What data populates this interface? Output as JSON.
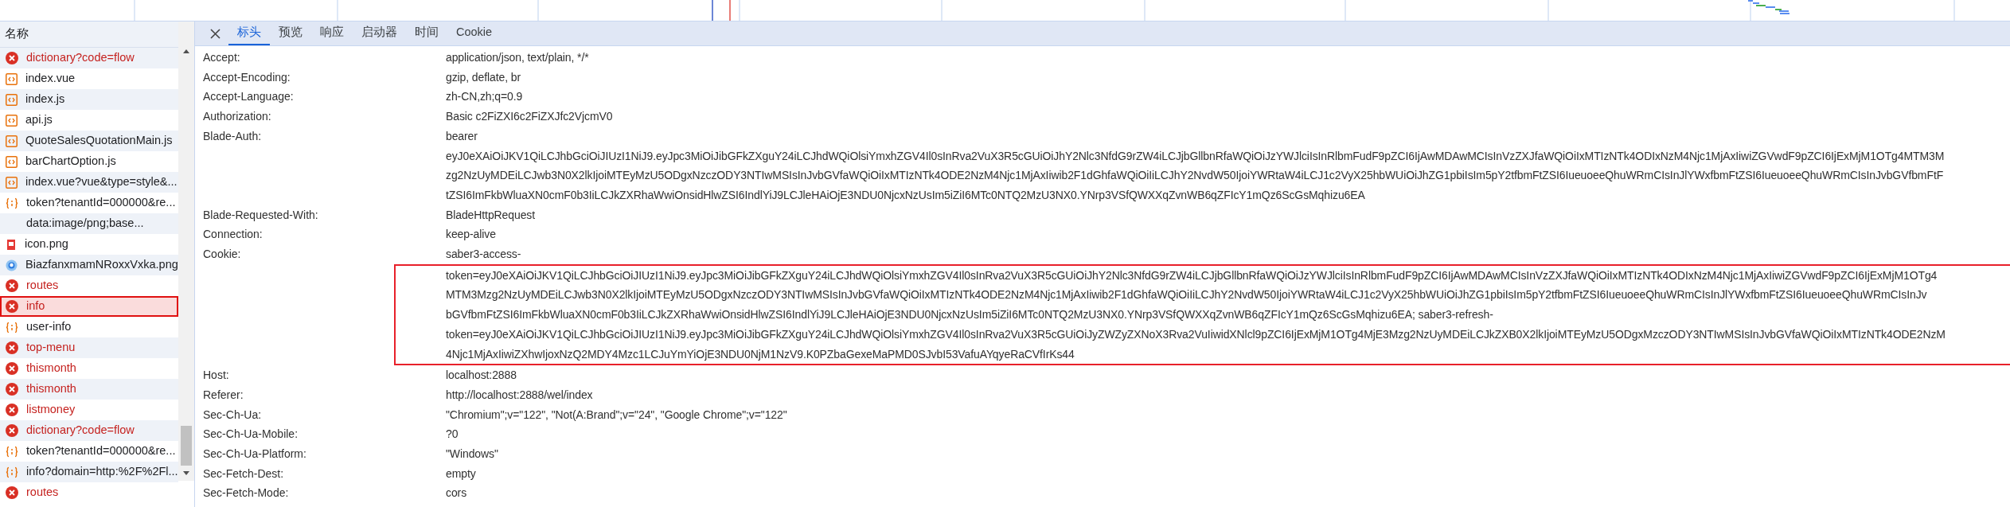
{
  "requests": {
    "header": "名称",
    "items": [
      {
        "name": "dictionary?code=flow",
        "kind": "error",
        "selected": false
      },
      {
        "name": "index.vue",
        "kind": "script",
        "selected": false
      },
      {
        "name": "index.js",
        "kind": "script",
        "selected": false
      },
      {
        "name": "api.js",
        "kind": "script",
        "selected": false
      },
      {
        "name": "QuoteSalesQuotationMain.js",
        "kind": "script",
        "selected": false
      },
      {
        "name": "barChartOption.js",
        "kind": "script",
        "selected": false
      },
      {
        "name": "index.vue?vue&type=style&...",
        "kind": "script",
        "selected": false
      },
      {
        "name": "token?tenantId=000000&re...",
        "kind": "fetch",
        "selected": false
      },
      {
        "name": "data:image/png;base...",
        "kind": "data",
        "selected": false
      },
      {
        "name": "icon.png",
        "kind": "image",
        "selected": false
      },
      {
        "name": "BiazfanxmamNRoxxVxka.png",
        "kind": "avatar",
        "selected": false
      },
      {
        "name": "routes",
        "kind": "error",
        "selected": false
      },
      {
        "name": "info",
        "kind": "error",
        "selected": true
      },
      {
        "name": "user-info",
        "kind": "fetch",
        "selected": false
      },
      {
        "name": "top-menu",
        "kind": "error",
        "selected": false
      },
      {
        "name": "thismonth",
        "kind": "error",
        "selected": false
      },
      {
        "name": "thismonth",
        "kind": "error",
        "selected": false
      },
      {
        "name": "listmoney",
        "kind": "error",
        "selected": false
      },
      {
        "name": "dictionary?code=flow",
        "kind": "error",
        "selected": false
      },
      {
        "name": "token?tenantId=000000&re...",
        "kind": "fetch",
        "selected": false
      },
      {
        "name": "info?domain=http:%2F%2Fl...",
        "kind": "fetch",
        "selected": false
      },
      {
        "name": "routes",
        "kind": "error",
        "selected": false
      }
    ]
  },
  "tabs": [
    {
      "label": "标头",
      "selected": true
    },
    {
      "label": "预览",
      "selected": false
    },
    {
      "label": "响应",
      "selected": false
    },
    {
      "label": "启动器",
      "selected": false
    },
    {
      "label": "时间",
      "selected": false
    },
    {
      "label": "Cookie",
      "selected": false
    }
  ],
  "headers": [
    {
      "name": "Accept:",
      "lines": [
        "application/json, text/plain, */*"
      ]
    },
    {
      "name": "Accept-Encoding:",
      "lines": [
        "gzip, deflate, br"
      ]
    },
    {
      "name": "Accept-Language:",
      "lines": [
        "zh-CN,zh;q=0.9"
      ]
    },
    {
      "name": "Authorization:",
      "lines": [
        "Basic c2FiZXI6c2FiZXJfc2VjcmV0"
      ]
    },
    {
      "name": "Blade-Auth:",
      "lines": [
        "bearer",
        "eyJ0eXAiOiJKV1QiLCJhbGciOiJIUzI1NiJ9.eyJpc3MiOiJibGFkZXguY24iLCJhdWQiOlsiYmxhZGV4Il0sInRva2VuX3R5cGUiOiJhY2Nlc3NfdG9rZW4iLCJjbGllbnRfaWQiOiJzYWJlciIsInRlbmFudF9pZCI6IjAwMDAwMCIsInVzZXJfaWQiOiIxMTIzNTk4ODIxNzM4Njc1MjAxIiwiZGVwdF9pZCI6IjExMjM1OTg4MTM3M",
        "zg2NzUyMDEiLCJwb3N0X2lkIjoiMTEyMzU5ODgxNzczODY3NTIwMSIsInJvbGVfaWQiOiIxMTIzNTk4ODE2NzM4Njc1MjAxIiwib2F1dGhfaWQiOiIiLCJhY2NvdW50IjoiYWRtaW4iLCJ1c2VyX25hbWUiOiJhZG1pbiIsIm5pY2tfbmFtZSI6IueuoeeQhuWRmCIsInJlYWxfbmFtZSI6IueuoeeQhuWRmCIsInJvbGVfbmFtF",
        "tZSI6ImFkbWluaXN0cmF0b3IiLCJkZXRhaWwiOnsidHlwZSI6IndlYiJ9LCJleHAiOjE3NDU0NjcxNzUsIm5iZiI6MTc0NTQ2MzU3NX0.YNrp3VSfQWXXqZvnWB6qZFIcY1mQz6ScGsMqhizu6EA"
      ]
    },
    {
      "name": "Blade-Requested-With:",
      "lines": [
        "BladeHttpRequest"
      ]
    },
    {
      "name": "Connection:",
      "lines": [
        "keep-alive"
      ]
    },
    {
      "name": "Cookie:",
      "lines": [
        "saber3-access-"
      ],
      "annotated_lines": [
        "token=eyJ0eXAiOiJKV1QiLCJhbGciOiJIUzI1NiJ9.eyJpc3MiOiJibGFkZXguY24iLCJhdWQiOlsiYmxhZGV4Il0sInRva2VuX3R5cGUiOiJhY2Nlc3NfdG9rZW4iLCJjbGllbnRfaWQiOiJzYWJlciIsInRlbmFudF9pZCI6IjAwMDAwMCIsInVzZXJfaWQiOiIxMTIzNTk4ODIxNzM4Njc1MjAxIiwiZGVwdF9pZCI6IjExMjM1OTg4",
        "MTM3Mzg2NzUyMDEiLCJwb3N0X2lkIjoiMTEyMzU5ODgxNzczODY3NTIwMSIsInJvbGVfaWQiOiIxMTIzNTk4ODE2NzM4Njc1MjAxIiwib2F1dGhfaWQiOiIiLCJhY2NvdW50IjoiYWRtaW4iLCJ1c2VyX25hbWUiOiJhZG1pbiIsIm5pY2tfbmFtZSI6IueuoeeQhuWRmCIsInJlYWxfbmFtZSI6IueuoeeQhuWRmCIsInJv",
        "bGVfbmFtZSI6ImFkbWluaXN0cmF0b3IiLCJkZXRhaWwiOnsidHlwZSI6IndlYiJ9LCJleHAiOjE3NDU0NjcxNzUsIm5iZiI6MTc0NTQ2MzU3NX0.YNrp3VSfQWXXqZvnWB6qZFIcY1mQz6ScGsMqhizu6EA; saber3-refresh-",
        "token=eyJ0eXAiOiJKV1QiLCJhbGciOiJIUzI1NiJ9.eyJpc3MiOiJibGFkZXguY24iLCJhdWQiOlsiYmxhZGV4Il0sInRva2VuX3R5cGUiOiJyZWZyZXNoX3Rva2VuIiwidXNlcl9pZCI6IjExMjM1OTg4MjE3Mzg2NzUyMDEiLCJkZXB0X2lkIjoiMTEyMzU5ODgxMzczODY3NTIwMSIsInJvbGVfaWQiOiIxMTIzNTk4ODE2NzM",
        "4Njc1MjAxIiwiZXhwIjoxNzQ2MDY4Mzc1LCJuYmYiOjE3NDU0NjM1NzV9.K0PZbaGexeMaPMD0SJvbI53VafuAYqyeRaCVfIrKs44"
      ]
    },
    {
      "name": "Host:",
      "lines": [
        "localhost:2888"
      ]
    },
    {
      "name": "Referer:",
      "lines": [
        "http://localhost:2888/wel/index"
      ]
    },
    {
      "name": "Sec-Ch-Ua:",
      "lines": [
        "\"Chromium\";v=\"122\", \"Not(A:Brand\";v=\"24\", \"Google Chrome\";v=\"122\""
      ]
    },
    {
      "name": "Sec-Ch-Ua-Mobile:",
      "lines": [
        "?0"
      ]
    },
    {
      "name": "Sec-Ch-Ua-Platform:",
      "lines": [
        "\"Windows\""
      ]
    },
    {
      "name": "Sec-Fetch-Dest:",
      "lines": [
        "empty"
      ]
    },
    {
      "name": "Sec-Fetch-Mode:",
      "lines": [
        "cors"
      ]
    }
  ]
}
